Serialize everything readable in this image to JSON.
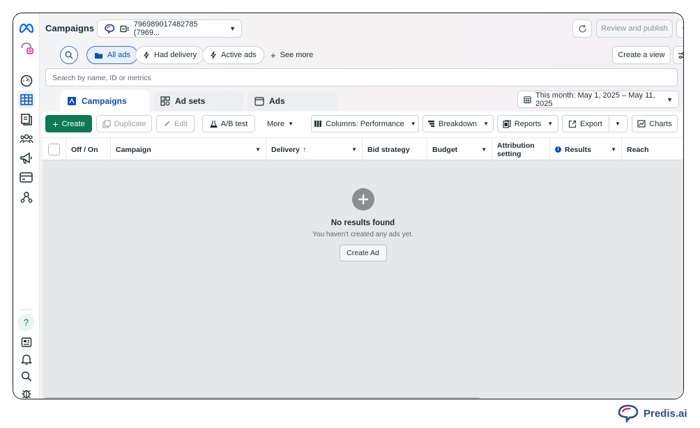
{
  "header": {
    "title": "Campaigns",
    "account_label": "796989017482785 (7969...",
    "review_publish_label": "Review and publish",
    "more_label": "···"
  },
  "filters": {
    "all_ads": "All ads",
    "had_delivery": "Had delivery",
    "active_ads": "Active ads",
    "see_more": "See more",
    "create_view": "Create a view"
  },
  "search": {
    "placeholder": "Search by name, ID or metrics"
  },
  "tabs": [
    {
      "label": "Campaigns"
    },
    {
      "label": "Ad sets"
    },
    {
      "label": "Ads"
    }
  ],
  "date_range": "This month: May 1, 2025 – May 11, 2025",
  "toolbar": {
    "create": "Create",
    "duplicate": "Duplicate",
    "edit": "Edit",
    "ab_test": "A/B test",
    "more": "More",
    "columns": "Columns: Performance",
    "breakdown": "Breakdown",
    "reports": "Reports",
    "export": "Export",
    "charts": "Charts"
  },
  "table": {
    "columns": [
      "Off / On",
      "Campaign",
      "Delivery",
      "Bid strategy",
      "Budget",
      "Attribution setting",
      "Results",
      "Reach"
    ]
  },
  "empty_state": {
    "title": "No results found",
    "subtitle": "You haven't created any ads yet.",
    "button": "Create Ad"
  },
  "brand": {
    "name": "Predis.ai"
  },
  "colors": {
    "primary_green": "#0a7a55",
    "link_blue": "#0b4fb5",
    "meta_blue": "#0866ff"
  }
}
